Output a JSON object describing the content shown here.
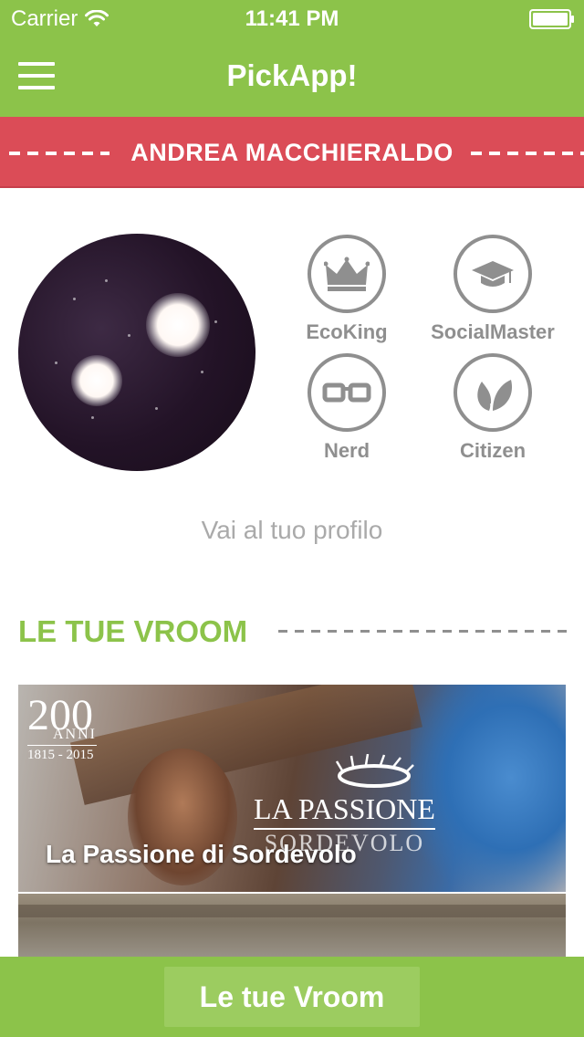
{
  "status_bar": {
    "carrier": "Carrier",
    "time": "11:41 PM",
    "wifi_icon": "wifi-icon",
    "battery_icon": "battery-icon"
  },
  "nav_bar": {
    "title": "PickApp!",
    "menu_icon": "hamburger-menu-icon",
    "background_color": "#8cc34a"
  },
  "profile": {
    "name": "ANDREA MACCHIERALDO",
    "banner_color": "#db4c57",
    "profile_link": "Vai al tuo profilo",
    "badges": [
      {
        "label": "EcoKing",
        "icon": "crown-icon"
      },
      {
        "label": "SocialMaster",
        "icon": "graduation-cap-icon"
      },
      {
        "label": "Nerd",
        "icon": "glasses-icon"
      },
      {
        "label": "Citizen",
        "icon": "leaf-icon"
      }
    ]
  },
  "section": {
    "title": "LE TUE VROOM"
  },
  "events": [
    {
      "title": "La Passione di Sordevolo",
      "poster_logo": {
        "anniversary_number": "200",
        "anniversary_word": "ANNI",
        "years": "1815 - 2015",
        "brand": "LA PASSIONE",
        "brand_sub": "SORDEVOLO"
      }
    }
  ],
  "bottom_bar": {
    "button_label": "Le tue Vroom"
  }
}
